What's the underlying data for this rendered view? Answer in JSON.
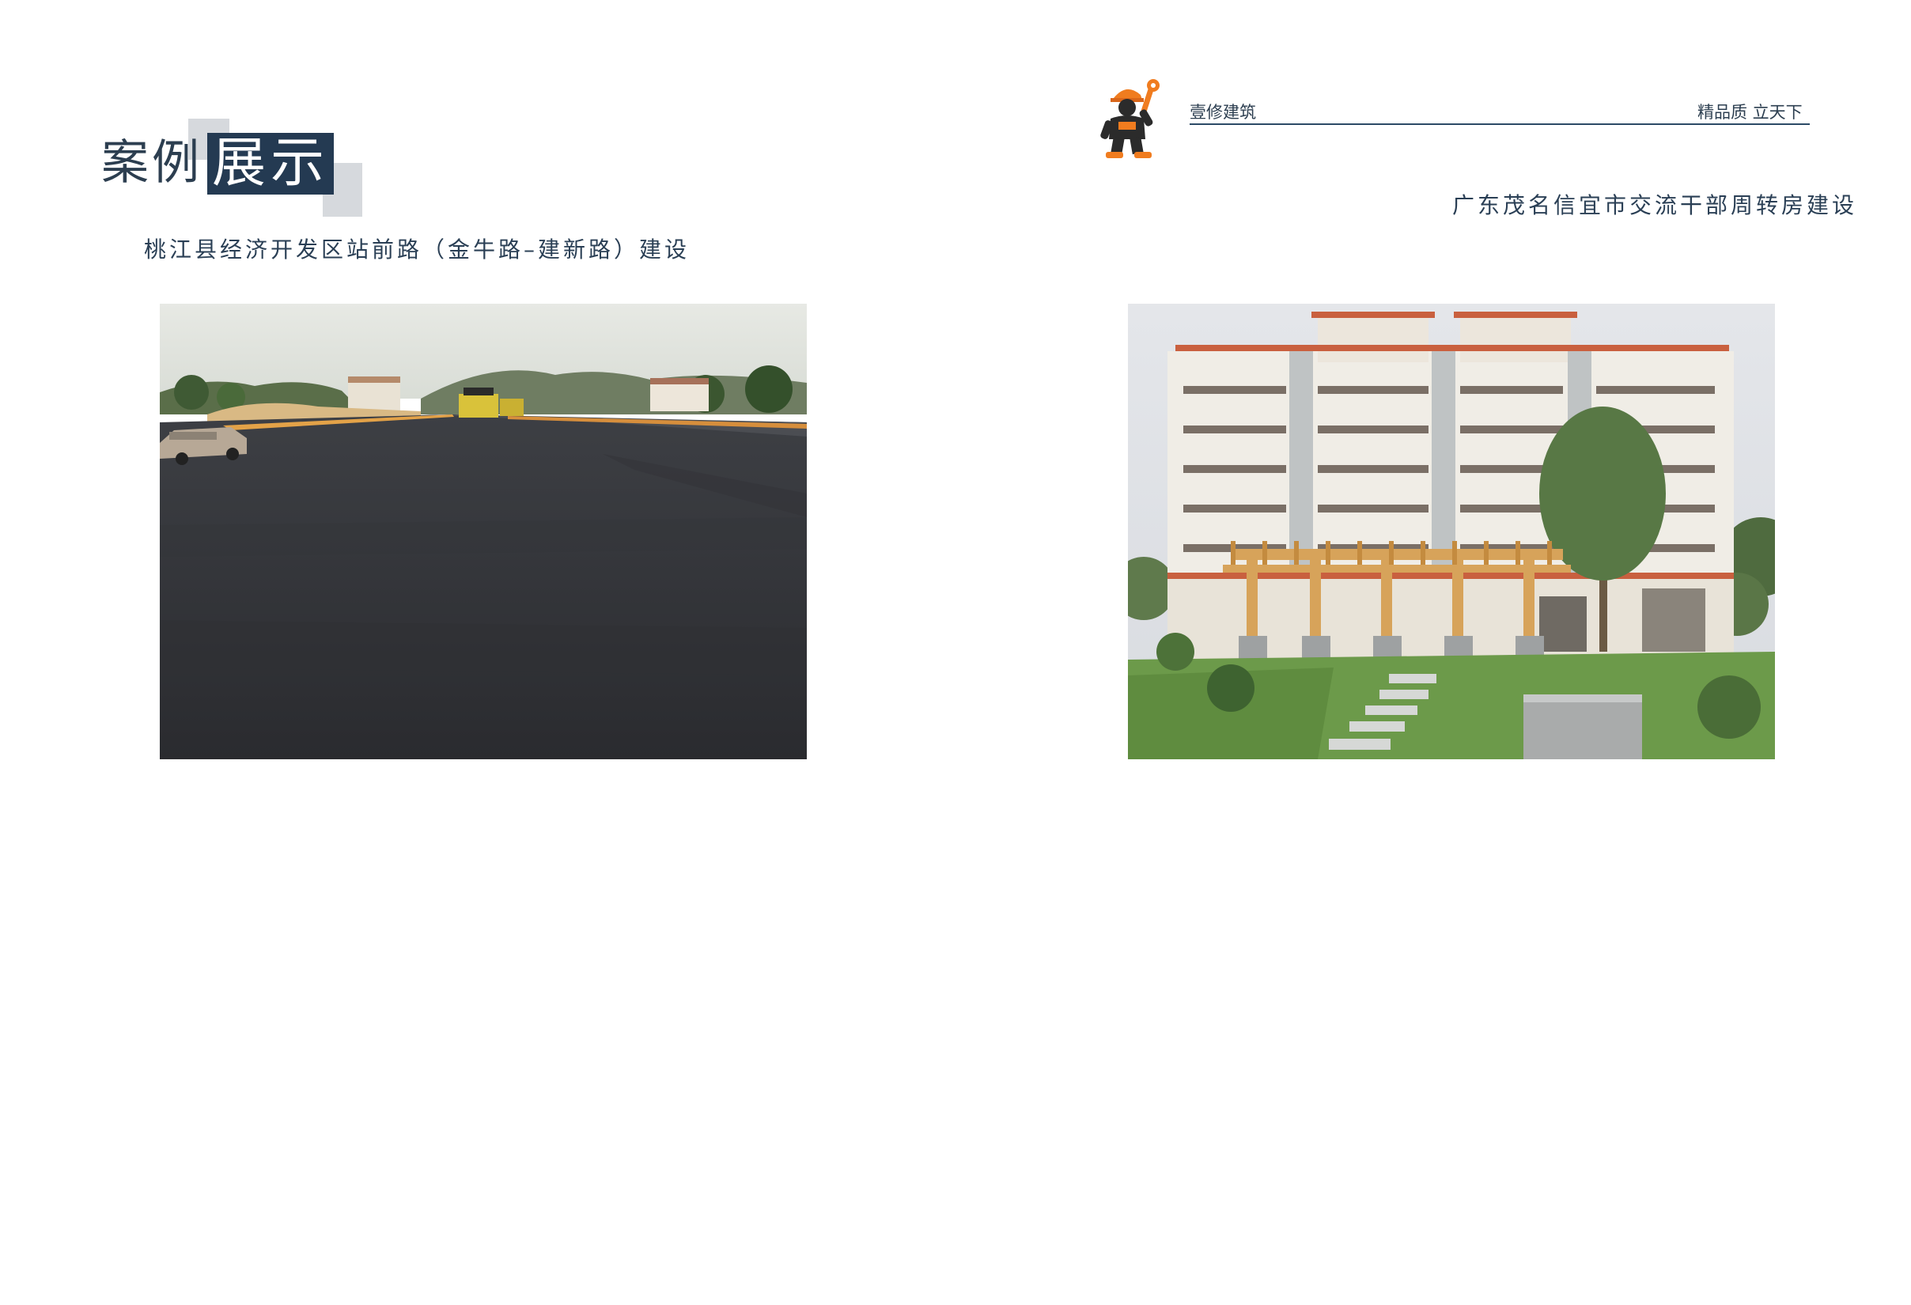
{
  "left_page": {
    "title_plain": "案例",
    "title_highlight": "展示",
    "caption": "桃江县经济开发区站前路（金牛路–建新路）建设"
  },
  "right_page": {
    "header": {
      "brand": "壹修建筑",
      "slogan": "精品质  立天下"
    },
    "caption": "广东茂名信宜市交流干部周转房建设"
  },
  "icons": {
    "mascot": "construction-worker-mascot-icon"
  },
  "colors": {
    "title_box": "#243a52",
    "text": "#2c3e50",
    "deco": "#d6d9dd",
    "mascot_orange": "#f07c1f"
  }
}
